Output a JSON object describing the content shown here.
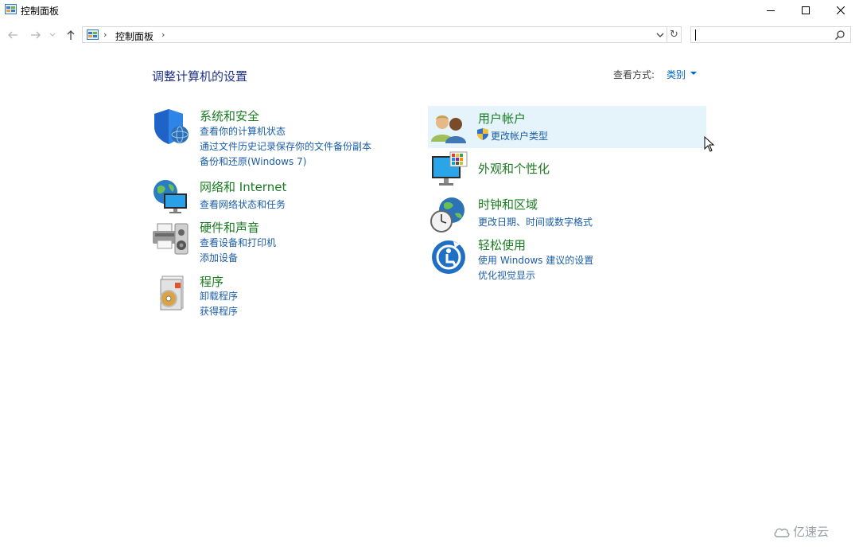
{
  "window": {
    "title": "控制面板",
    "controls": [
      "minimize",
      "maximize",
      "close"
    ]
  },
  "address_bar": {
    "breadcrumb": "控制面板",
    "search_placeholder": ""
  },
  "main": {
    "heading": "调整计算机的设置",
    "view_by_label": "查看方式:",
    "view_by_value": "类别",
    "categories": [
      {
        "title": "系统和安全",
        "icon": "shield-icon",
        "links": [
          "查看你的计算机状态",
          "通过文件历史记录保存你的文件备份副本",
          "备份和还原(Windows 7)"
        ]
      },
      {
        "title": "网络和 Internet",
        "icon": "network-globe-icon",
        "links": [
          "查看网络状态和任务"
        ]
      },
      {
        "title": "硬件和声音",
        "icon": "printer-speaker-icon",
        "links": [
          "查看设备和打印机",
          "添加设备"
        ]
      },
      {
        "title": "程序",
        "icon": "programs-disc-icon",
        "links": [
          "卸载程序",
          "获得程序"
        ]
      },
      {
        "title": "用户帐户",
        "icon": "users-icon",
        "links": [
          "更改帐户类型"
        ]
      },
      {
        "title": "外观和个性化",
        "icon": "monitor-palette-icon",
        "links": []
      },
      {
        "title": "时钟和区域",
        "icon": "clock-globe-icon",
        "links": [
          "更改日期、时间或数字格式"
        ]
      },
      {
        "title": "轻松使用",
        "icon": "accessibility-icon",
        "links": [
          "使用 Windows 建议的设置",
          "优化视觉显示"
        ]
      }
    ]
  },
  "watermark": "亿速云",
  "colors": {
    "category_title": "#1a7c21",
    "link": "#1c5ea8",
    "heading": "#1e3287",
    "hover": "#e5f3fb"
  }
}
